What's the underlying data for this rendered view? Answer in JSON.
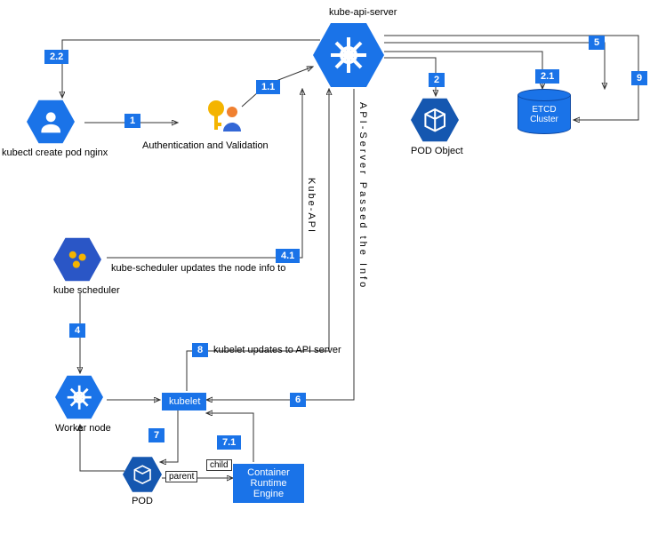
{
  "title": "kube-api-server",
  "nodes": {
    "kubectl": {
      "label": "kubectl create pod nginx"
    },
    "auth": {
      "label": "Authentication and Validation"
    },
    "apiserver": {
      "label": "kube-api-server"
    },
    "podobject": {
      "label": "POD Object"
    },
    "etcd": {
      "label": "ETCD Cluster"
    },
    "scheduler": {
      "label": "kube scheduler",
      "edge": "kube-scheduler updates the node info to"
    },
    "worker": {
      "label": "Worker node"
    },
    "kubelet": {
      "label": "kubelet",
      "edge": "kubelet updates to API server"
    },
    "pod": {
      "label": "POD"
    },
    "cre": {
      "label": "Container Runtime Engine"
    },
    "parent": "parent",
    "child": "child",
    "side1": "Kube-API",
    "side2": "API-Server Passed the Info"
  },
  "steps": {
    "s1": "1",
    "s1_1": "1.1",
    "s2": "2",
    "s2_1": "2.1",
    "s2_2": "2.2",
    "s4": "4",
    "s4_1": "4.1",
    "s5": "5",
    "s6": "6",
    "s7": "7",
    "s7_1": "7.1",
    "s8": "8",
    "s9": "9"
  }
}
